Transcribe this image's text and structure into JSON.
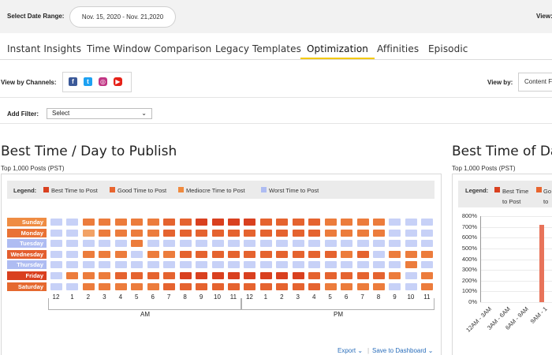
{
  "header": {
    "date_range_label": "Select Date Range:",
    "date_range_value": "Nov. 15, 2020 - Nov. 21,2020",
    "view_label": "View:"
  },
  "tabs": [
    {
      "label": "Instant Insights",
      "active": false
    },
    {
      "label": "Time Window Comparison",
      "active": false
    },
    {
      "label": "Legacy Templates",
      "active": false
    },
    {
      "label": "Optimization",
      "active": true
    },
    {
      "label": "Affinities",
      "active": false
    },
    {
      "label": "Episodic",
      "active": false
    }
  ],
  "channels": {
    "label": "View by Channels:",
    "icons": [
      "facebook-icon",
      "twitter-icon",
      "instagram-icon",
      "youtube-icon"
    ],
    "view_by_label": "View by:",
    "view_by_value": "Content F"
  },
  "filter": {
    "label": "Add Filter:",
    "select_value": "Select"
  },
  "left_panel": {
    "title": "Best Time / Day to Publish",
    "subtitle": "Top 1,000 Posts (PST)",
    "legend_title": "Legend:",
    "legend": [
      {
        "label": "Best Time to Post",
        "color": "#d9401f"
      },
      {
        "label": "Good Time to Post",
        "color": "#e8652f"
      },
      {
        "label": "Mediocre Time to Post",
        "color": "#f08a3e"
      },
      {
        "label": "Worst Time to Post",
        "color": "#aebcf2"
      }
    ],
    "days": [
      {
        "name": "Sunday",
        "color": "#ef8c43"
      },
      {
        "name": "Monday",
        "color": "#e97235"
      },
      {
        "name": "Tuesday",
        "color": "#aebcf2"
      },
      {
        "name": "Wednesday",
        "color": "#e35e2e"
      },
      {
        "name": "Thursday",
        "color": "#aebcf2"
      },
      {
        "name": "Friday",
        "color": "#d9401f"
      },
      {
        "name": "Saturday",
        "color": "#e5692f"
      }
    ],
    "hours": [
      "12",
      "1",
      "2",
      "3",
      "4",
      "5",
      "6",
      "7",
      "8",
      "9",
      "10",
      "11",
      "12",
      "1",
      "2",
      "3",
      "4",
      "5",
      "6",
      "7",
      "8",
      "9",
      "10",
      "11"
    ],
    "am_label": "AM",
    "pm_label": "PM",
    "palette": [
      "#c7d1f7",
      "#f2a266",
      "#ec7c3c",
      "#e5632f",
      "#d9401f"
    ],
    "grid": [
      [
        0,
        0,
        2,
        2,
        2,
        2,
        2,
        3,
        3,
        4,
        4,
        4,
        4,
        3,
        3,
        3,
        3,
        2,
        2,
        2,
        2,
        0,
        0,
        0
      ],
      [
        0,
        0,
        1,
        2,
        2,
        2,
        2,
        3,
        3,
        3,
        3,
        3,
        3,
        3,
        3,
        3,
        3,
        2,
        2,
        2,
        2,
        0,
        0,
        0
      ],
      [
        0,
        0,
        0,
        0,
        0,
        2,
        0,
        0,
        0,
        0,
        0,
        0,
        0,
        0,
        0,
        0,
        0,
        0,
        0,
        0,
        0,
        0,
        0,
        0
      ],
      [
        0,
        0,
        2,
        2,
        2,
        0,
        2,
        2,
        3,
        3,
        3,
        3,
        3,
        3,
        3,
        3,
        3,
        3,
        2,
        3,
        0,
        2,
        2,
        2
      ],
      [
        0,
        0,
        0,
        0,
        0,
        0,
        0,
        0,
        0,
        0,
        0,
        0,
        0,
        0,
        0,
        0,
        0,
        0,
        0,
        0,
        0,
        0,
        2,
        0
      ],
      [
        0,
        2,
        2,
        2,
        3,
        3,
        3,
        3,
        4,
        4,
        4,
        4,
        4,
        4,
        4,
        4,
        3,
        3,
        3,
        3,
        3,
        2,
        0,
        2
      ],
      [
        0,
        0,
        2,
        2,
        2,
        2,
        2,
        3,
        3,
        3,
        3,
        3,
        3,
        3,
        3,
        3,
        3,
        2,
        2,
        2,
        2,
        0,
        0,
        2
      ]
    ],
    "export_label": "Export",
    "save_label": "Save to Dashboard"
  },
  "right_panel": {
    "title": "Best Time of Da",
    "subtitle": "Top 1,000 Posts (PST)",
    "legend_title": "Legend:",
    "legend": [
      {
        "label": "Best Time to Post",
        "color": "#d9401f"
      },
      {
        "label": "Go to",
        "color": "#e8652f"
      }
    ]
  },
  "chart_data": {
    "type": "bar",
    "categories": [
      "12AM - 3AM",
      "3AM - 6AM",
      "6AM - 9AM",
      "9AM - 1"
    ],
    "values": [
      0,
      0,
      0,
      720
    ],
    "ylim": [
      0,
      800
    ],
    "yticks": [
      "0%",
      "100%",
      "200%",
      "300%",
      "400%",
      "500%",
      "600%",
      "700%",
      "800%"
    ],
    "grid": true,
    "bar_color": "#e8735a"
  }
}
